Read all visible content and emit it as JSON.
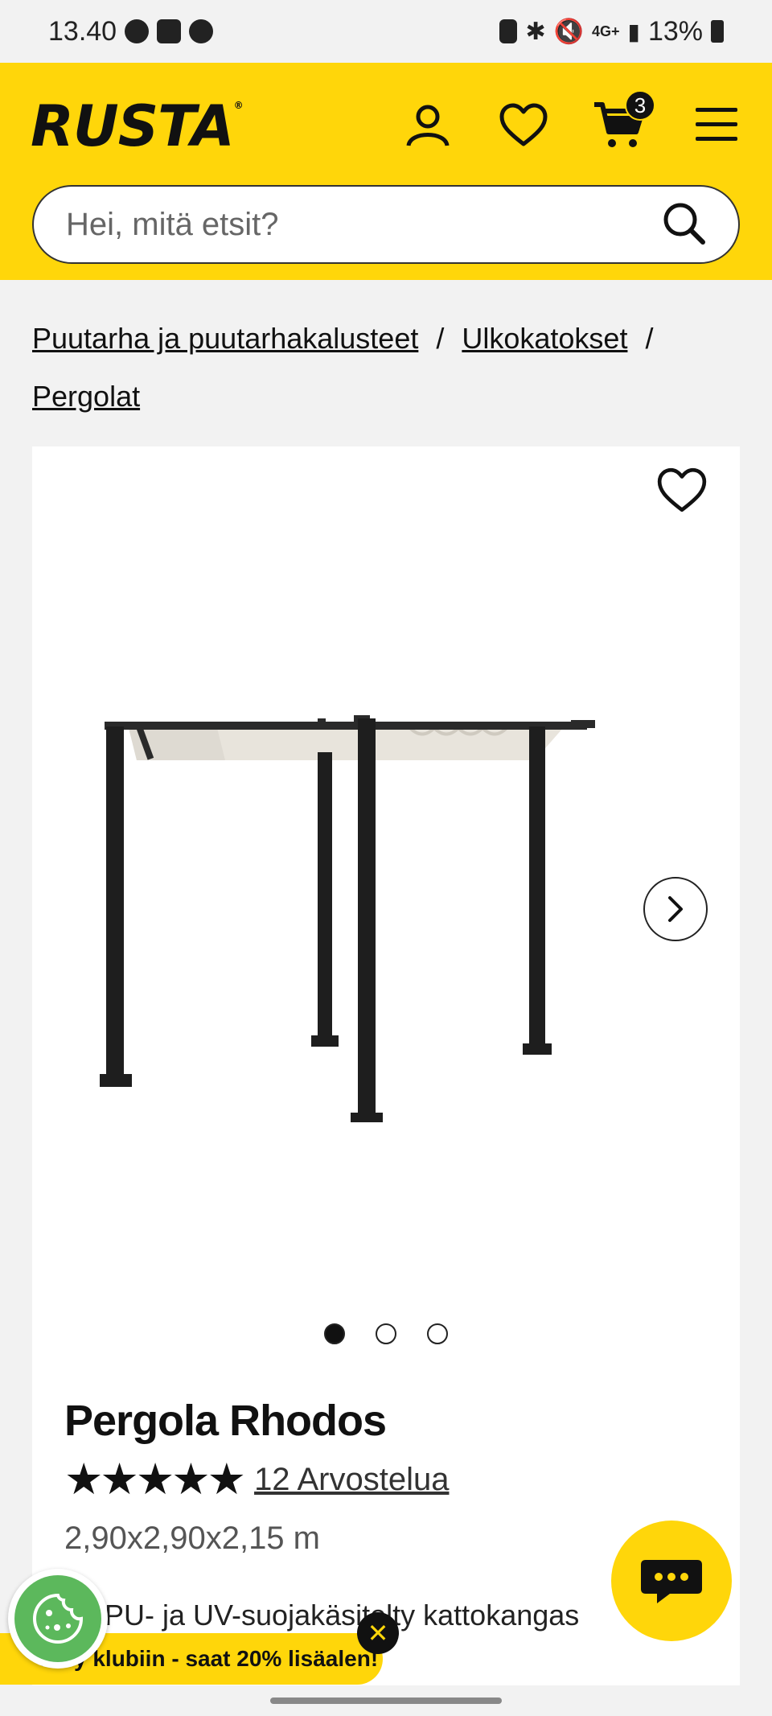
{
  "status_bar": {
    "time": "13.40",
    "battery": "13%",
    "network": "4G+"
  },
  "header": {
    "logo": "RUSTA",
    "cart_count": "3",
    "search_placeholder": "Hei, mitä etsit?",
    "background_color": "#ffd60a"
  },
  "breadcrumb": {
    "items": [
      "Puutarha ja puutarhakalusteet",
      "Ulkokatokset",
      "Pergolat"
    ],
    "separator": "/"
  },
  "product": {
    "title": "Pergola Rhodos",
    "rating_stars": 5,
    "stars_display": "★★★★★",
    "reviews": "12 Arvostelua",
    "dimensions": "2,90x2,90x2,15 m",
    "feature": "PU- ja UV-suojakäsitelty kattokangas",
    "image_count": 3,
    "active_image": 1
  },
  "promo": {
    "text": "Liity klubiin - saat 20% lisäalen!",
    "close": "✕"
  },
  "icons": [
    "account-icon",
    "heart-icon",
    "cart-icon",
    "menu-icon",
    "search-icon",
    "chevron-right-icon",
    "chat-icon",
    "cookie-icon"
  ]
}
